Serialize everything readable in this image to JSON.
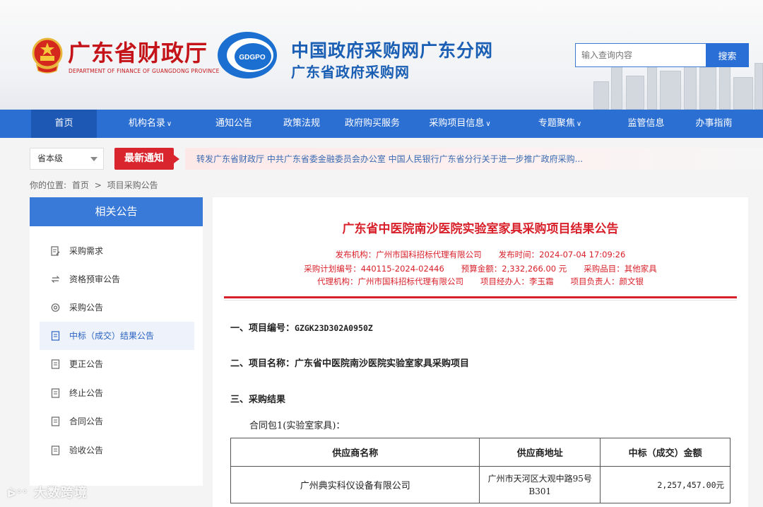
{
  "header": {
    "dept_cn": "广东省财政厅",
    "dept_en": "DEPARTMENT OF FINANCE OF GUANGDONG PROVINCE",
    "logo_text": "GDGPO",
    "site_title_1": "中国政府采购网广东分网",
    "site_title_2": "广东省政府采购网",
    "search_placeholder": "输入查询内容",
    "search_button": "搜索"
  },
  "nav": {
    "items": [
      {
        "label": "首页",
        "active": true
      },
      {
        "label": "机构名录",
        "dropdown": true
      },
      {
        "label": "通知公告"
      },
      {
        "label": "政策法规"
      },
      {
        "label": "政府购买服务"
      },
      {
        "label": "采购项目信息",
        "dropdown": true
      },
      {
        "label": "专题聚焦",
        "dropdown": true
      },
      {
        "label": "监管信息"
      },
      {
        "label": "办事指南"
      }
    ],
    "chevron": "∨"
  },
  "notice": {
    "level_select": "省本级",
    "badge": "最新通知",
    "headline": "转发广东省财政厅 中共广东省委金融委员会办公室 中国人民银行广东省分行关于进一步推广政府采购..."
  },
  "breadcrumb": {
    "prefix": "你的位置:",
    "home": "首页",
    "sep": ">",
    "current": "项目采购公告"
  },
  "sidebar": {
    "title": "相关公告",
    "items": [
      {
        "label": "采购需求",
        "icon": "doc-edit-icon"
      },
      {
        "label": "资格预审公告",
        "icon": "swap-icon"
      },
      {
        "label": "采购公告",
        "icon": "target-icon"
      },
      {
        "label": "中标（成交）结果公告",
        "icon": "doc-icon",
        "active": true
      },
      {
        "label": "更正公告",
        "icon": "doc-icon"
      },
      {
        "label": "终止公告",
        "icon": "doc-icon"
      },
      {
        "label": "合同公告",
        "icon": "doc-icon"
      },
      {
        "label": "验收公告",
        "icon": "doc-icon"
      }
    ]
  },
  "article": {
    "title": "广东省中医院南沙医院实验室家具采购项目结果公告",
    "meta_line1": [
      "发布机构：广州市国科招标代理有限公司",
      "发布时间：2024-07-04 17:09:26"
    ],
    "meta_line2": [
      "采购计划编号：440115-2024-02446",
      "预算金额：2,332,266.00 元",
      "采购品目：其他家具"
    ],
    "meta_line3": [
      "代理机构：广州市国科招标代理有限公司",
      "项目经办人：李玉霜",
      "项目负责人：颜文银"
    ],
    "sec1_label": "一、项目编号：",
    "sec1_value": "GZGK23D302A0950Z",
    "sec2_label": "二、项目名称：",
    "sec2_value": "广东省中医院南沙医院实验室家具采购项目",
    "sec3_label": "三、采购结果",
    "package": "合同包1(实验室家具)："
  },
  "result_table": {
    "headers": [
      "供应商名称",
      "供应商地址",
      "中标（成交）金额"
    ],
    "rows": [
      {
        "name": "广州典实科仪设备有限公司",
        "address": "广州市天河区大观中路95号B301",
        "amount": "2,257,457.00元"
      }
    ]
  },
  "watermark": {
    "logo": "ᐖ°°",
    "text": "大数跨境"
  },
  "colors": {
    "primary_blue": "#2c6fd3",
    "accent_red": "#d8202a",
    "dept_red": "#c4141a"
  }
}
